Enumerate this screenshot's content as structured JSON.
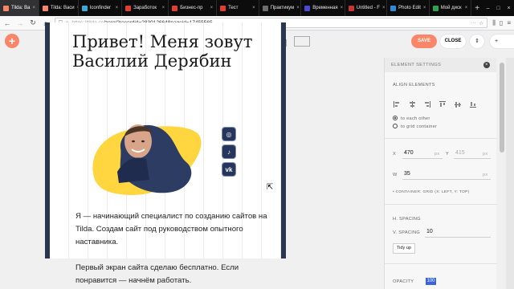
{
  "tabs": [
    {
      "title": "Tilda: Ва",
      "color": "#fa8669",
      "active": true
    },
    {
      "title": "Tilda: Васи",
      "color": "#fa8669"
    },
    {
      "title": "Iconfinder",
      "color": "#38a8d8"
    },
    {
      "title": "Заработок",
      "color": "#e03e2f"
    },
    {
      "title": "Бизнес-пр",
      "color": "#e03e2f"
    },
    {
      "title": "Тест",
      "color": "#e03e2f"
    },
    {
      "title": "Практикум",
      "color": "#6c6c6c"
    },
    {
      "title": "Временная",
      "color": "#4a4ad0"
    },
    {
      "title": "Untitled - F",
      "color": "#cc3333"
    },
    {
      "title": "Photo Edit",
      "color": "#2b8bd8"
    },
    {
      "title": "Мой диск",
      "color": "#2ca24c"
    }
  ],
  "url": {
    "prefix": "https://tilda.cc",
    "rest": "/zero/?recordid=2830126648pageid=17455565"
  },
  "toolbar": {
    "add_label": "+",
    "save_label": "SAVE",
    "close_label": "CLOSE",
    "more_label": "⇕",
    "more2_label": "+"
  },
  "page": {
    "headline": "Привет! Меня зовут Василий Дерябин",
    "paragraph1": "Я — начинающий специалист по созданию сайтов на Tilda. Создам сайт под руководством опытного наставника.",
    "paragraph2": "Первый экран сайта сделаю бесплатно. Если понравится — начнём работать.",
    "social": [
      {
        "icon": "instagram-icon",
        "glyph": "◎"
      },
      {
        "icon": "tiktok-icon",
        "glyph": "♪"
      },
      {
        "icon": "vk-icon",
        "glyph": "vk"
      }
    ]
  },
  "panel": {
    "title": "ELEMENT SETTINGS",
    "align_label": "ALIGN ELEMENTS",
    "to_each_other": "to each other",
    "to_grid_container": "to grid container",
    "x_label": "X",
    "x_value": "470",
    "x_unit": "px",
    "y_label": "Y",
    "y_value": "415",
    "y_unit": "px",
    "w_label": "W",
    "w_value": "35",
    "w_unit": "px",
    "container_note": "• CONTAINER: GRID (X: LEFT, Y: TOP)",
    "h_spacing_label": "H. SPACING",
    "v_spacing_label": "V. SPACING",
    "v_spacing_value": "10",
    "tidy_label": "Tidy up",
    "opacity_label": "OPACITY",
    "opacity_value": "100"
  }
}
